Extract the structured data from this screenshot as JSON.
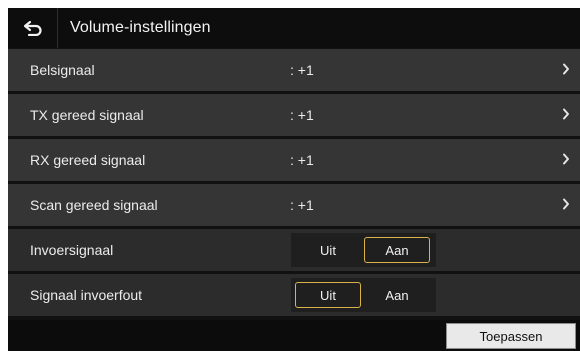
{
  "header": {
    "back_icon": "back-arrow-icon",
    "title": "Volume-instellingen"
  },
  "rows": [
    {
      "label": "Belsignaal",
      "value": ": +1"
    },
    {
      "label": "TX gereed signaal",
      "value": ": +1"
    },
    {
      "label": "RX gereed signaal",
      "value": ": +1"
    },
    {
      "label": "Scan gereed signaal",
      "value": ": +1"
    }
  ],
  "toggles": [
    {
      "label": "Invoersignaal",
      "off": "Uit",
      "on": "Aan",
      "selected": "Aan"
    },
    {
      "label": "Signaal invoerfout",
      "off": "Uit",
      "on": "Aan",
      "selected": "Uit"
    }
  ],
  "footer": {
    "apply_label": "Toepassen"
  },
  "colors": {
    "background": "#111111",
    "row": "#353535",
    "selected_border": "#d8b24a",
    "apply_button": "#e9e9e9"
  }
}
